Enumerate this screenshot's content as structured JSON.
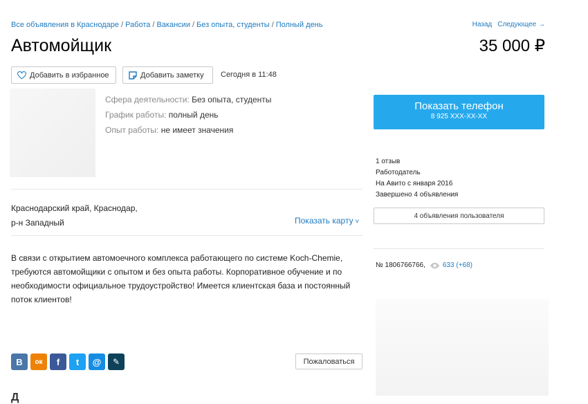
{
  "breadcrumbs": [
    "Все объявления в Краснодаре",
    "Работа",
    "Вакансии",
    "Без опыта, студенты",
    "Полный день"
  ],
  "nav": {
    "back": "Назад",
    "next": "Следующее →"
  },
  "title": "Автомойщик",
  "price": "35 000 ₽",
  "actions": {
    "favorite": "Добавить в избранное",
    "note": "Добавить заметку",
    "date": "Сегодня в 11:48"
  },
  "params": [
    {
      "key": "Сфера деятельности:",
      "value": "Без опыта, студенты"
    },
    {
      "key": "График работы:",
      "value": "полный день"
    },
    {
      "key": "Опыт работы:",
      "value": "не имеет значения"
    }
  ],
  "address": {
    "line1": "Краснодарский край, Краснодар,",
    "line2": "р-н Западный",
    "map_link": "Показать карту"
  },
  "description": "В связи с открытием автомоечного комплекса работающего по системе Koch-Chemie, требуются автомойщики с опытом и без опыта работы. Корпоративное обучение и по необходимости официальное трудоустройство! Имеется клиентская база и постоянный поток клиентов!",
  "phone": {
    "label": "Показать телефон",
    "number": "8 925 XXX-XX-XX"
  },
  "seller": {
    "reviews": "1 отзыв",
    "type": "Работодатель",
    "since": "На Авито с января 2016",
    "completed": "Завершено 4 объявления"
  },
  "user_ads_button": "4 объявления пользователя",
  "ad": {
    "number": "№ 1806766766,",
    "views": "633 (+68)"
  },
  "share": [
    {
      "icon": "vk-icon",
      "glyph": "В",
      "color": "#4a76a8"
    },
    {
      "icon": "odnoklassniki-icon",
      "glyph": "ок",
      "color": "#ee8208"
    },
    {
      "icon": "facebook-icon",
      "glyph": "f",
      "color": "#3b5998"
    },
    {
      "icon": "twitter-icon",
      "glyph": "t",
      "color": "#1da1f2"
    },
    {
      "icon": "mail-icon",
      "glyph": "@",
      "color": "#168de2"
    },
    {
      "icon": "livejournal-icon",
      "glyph": "✎",
      "color": "#0d425a"
    }
  ],
  "report_button": "Пожаловаться",
  "bottom_heading": "Д"
}
